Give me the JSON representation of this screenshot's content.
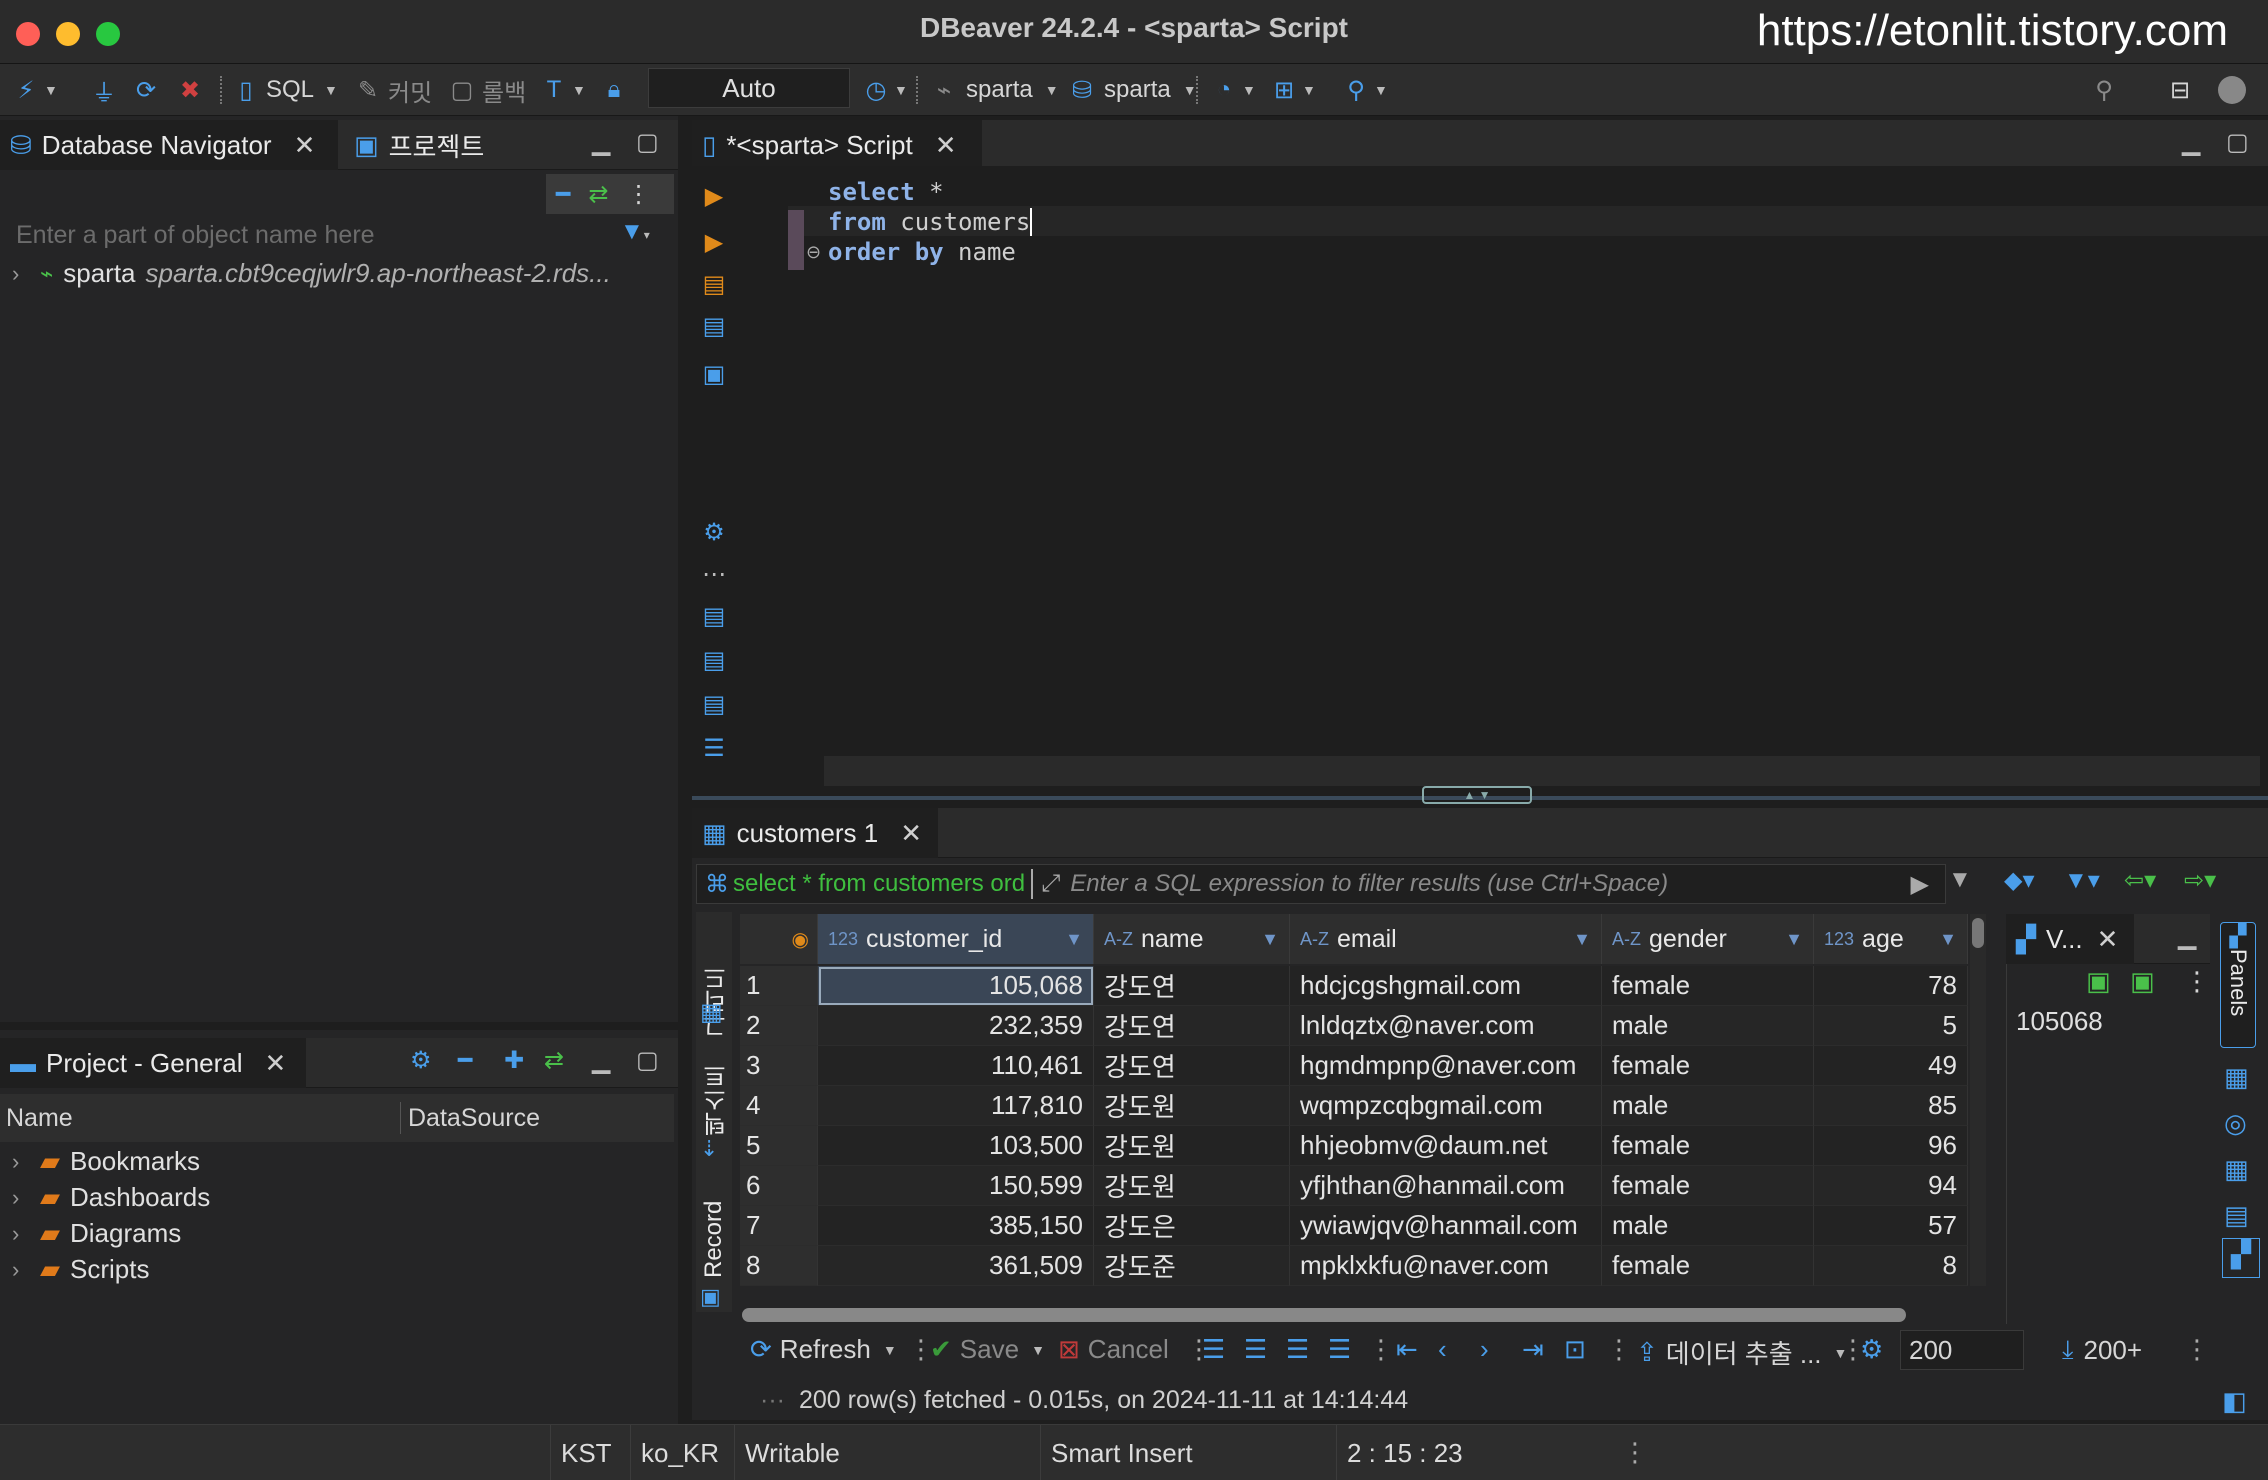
{
  "window": {
    "title": "DBeaver 24.2.4 - <sparta> Script",
    "watermark": "https://etonlit.tistory.com"
  },
  "toolbar": {
    "sql_label": "SQL",
    "commit_label": "커밋",
    "rollback_label": "롤백",
    "transaction_mode": "Auto",
    "datasource": "sparta",
    "schema": "sparta"
  },
  "navigator": {
    "tab_label": "Database Navigator",
    "projects_tab_label": "프로젝트",
    "filter_placeholder": "Enter a part of object name here",
    "connection_name": "sparta",
    "connection_host": "sparta.cbt9ceqjwlr9.ap-northeast-2.rds..."
  },
  "project_panel": {
    "tab_label": "Project - General",
    "col_name": "Name",
    "col_datasource": "DataSource",
    "items": [
      "Bookmarks",
      "Dashboards",
      "Diagrams",
      "Scripts"
    ]
  },
  "editor": {
    "tab_label": "*<sparta> Script",
    "line1_kw": "select",
    "line1_rest": " *",
    "line2_kw": "from",
    "line2_rest": " customers",
    "line3_kw1": "order",
    "line3_kw2": "by",
    "line3_rest": " name"
  },
  "results": {
    "tab_label": "customers 1",
    "query_preview": "select * from customers ord",
    "filter_placeholder": "Enter a SQL expression to filter results (use Ctrl+Space)",
    "side_tabs": {
      "grid": "그리드",
      "text": "텍스트",
      "record": "Record"
    },
    "columns": [
      {
        "type": "123",
        "name": "customer_id"
      },
      {
        "type": "A-Z",
        "name": "name"
      },
      {
        "type": "A-Z",
        "name": "email"
      },
      {
        "type": "A-Z",
        "name": "gender"
      },
      {
        "type": "123",
        "name": "age"
      }
    ],
    "rows": [
      {
        "n": "1",
        "id": "105,068",
        "name": "강도연",
        "email": "hdcjcgshgmail.com",
        "gender": "female",
        "age": "78"
      },
      {
        "n": "2",
        "id": "232,359",
        "name": "강도연",
        "email": "lnldqztx@naver.com",
        "gender": "male",
        "age": "5"
      },
      {
        "n": "3",
        "id": "110,461",
        "name": "강도연",
        "email": "hgmdmpnp@naver.com",
        "gender": "female",
        "age": "49"
      },
      {
        "n": "4",
        "id": "117,810",
        "name": "강도원",
        "email": "wqmpzcqbgmail.com",
        "gender": "male",
        "age": "85"
      },
      {
        "n": "5",
        "id": "103,500",
        "name": "강도원",
        "email": "hhjeobmv@daum.net",
        "gender": "female",
        "age": "96"
      },
      {
        "n": "6",
        "id": "150,599",
        "name": "강도원",
        "email": "yfjhthan@hanmail.com",
        "gender": "female",
        "age": "94"
      },
      {
        "n": "7",
        "id": "385,150",
        "name": "강도은",
        "email": "ywiawjqv@hanmail.com",
        "gender": "male",
        "age": "57"
      },
      {
        "n": "8",
        "id": "361,509",
        "name": "강도준",
        "email": "mpklxkfu@naver.com",
        "gender": "female",
        "age": "8"
      }
    ],
    "value_panel": {
      "tab_label": "V...",
      "value": "105068",
      "panels_label": "Panels"
    },
    "bottom": {
      "refresh": "Refresh",
      "save": "Save",
      "cancel": "Cancel",
      "export": "데이터 추출 ...",
      "fetch_size": "200",
      "fetch_more": "200+",
      "status": "200 row(s) fetched - 0.015s, on 2024-11-11 at 14:14:44"
    }
  },
  "statusbar": {
    "timezone": "KST",
    "locale": "ko_KR",
    "mode": "Writable",
    "insert_mode": "Smart Insert",
    "cursor": "2 : 15 : 23"
  },
  "colors": {
    "accent_blue": "#4a9eea",
    "keyword": "#8fb3e8",
    "query_green": "#3fbf3f"
  }
}
